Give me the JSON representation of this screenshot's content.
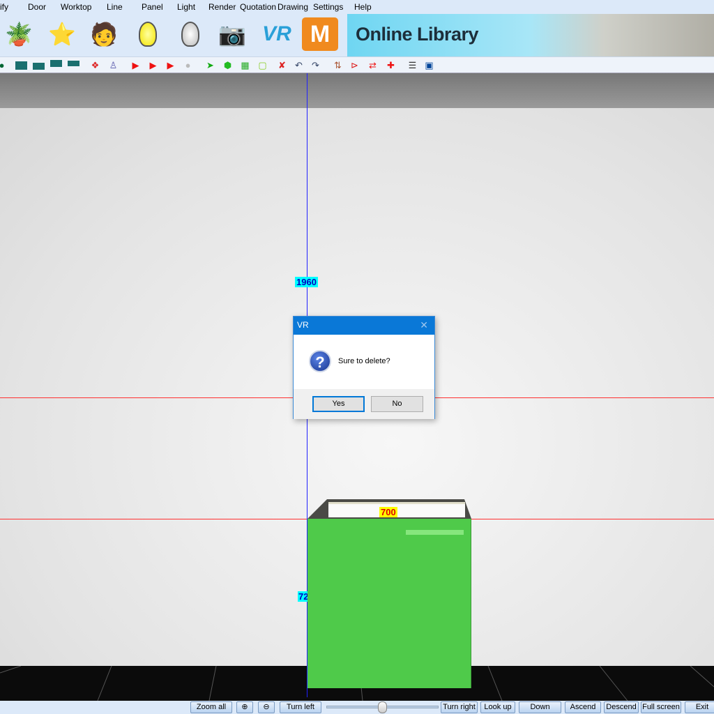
{
  "menu": [
    "ify",
    "Door",
    "Worktop",
    "Line",
    "Panel",
    "Light",
    "Render",
    "Quotation",
    "Drawing",
    "Settings",
    "Help"
  ],
  "icons": [
    "flowerpot-icon",
    "star-wand-icon",
    "material-person-icon",
    "light-bulb-on-icon",
    "light-bulb-off-icon",
    "photo-camera-icon",
    "vr-icon",
    "m-logo-icon"
  ],
  "online_library": "Online Library",
  "viewport": {
    "dim_height": "1960",
    "dim_width": "700",
    "dim_cabinet_height": "72",
    "colors": {
      "cabinet": "#4fca4a",
      "dim_label_bg": "#00ffff",
      "width_label_bg": "#ffff00"
    }
  },
  "dialog": {
    "title": "VR",
    "message": "Sure to delete?",
    "yes": "Yes",
    "no": "No"
  },
  "status": {
    "zoom_all": "Zoom all",
    "turn_left": "Turn left",
    "turn_right": "Turn right",
    "look_up": "Look up",
    "down": "Down",
    "ascend": "Ascend",
    "descend": "Descend",
    "full_screen": "Full screen",
    "exit": "Exit",
    "slider_value": 0.5
  }
}
